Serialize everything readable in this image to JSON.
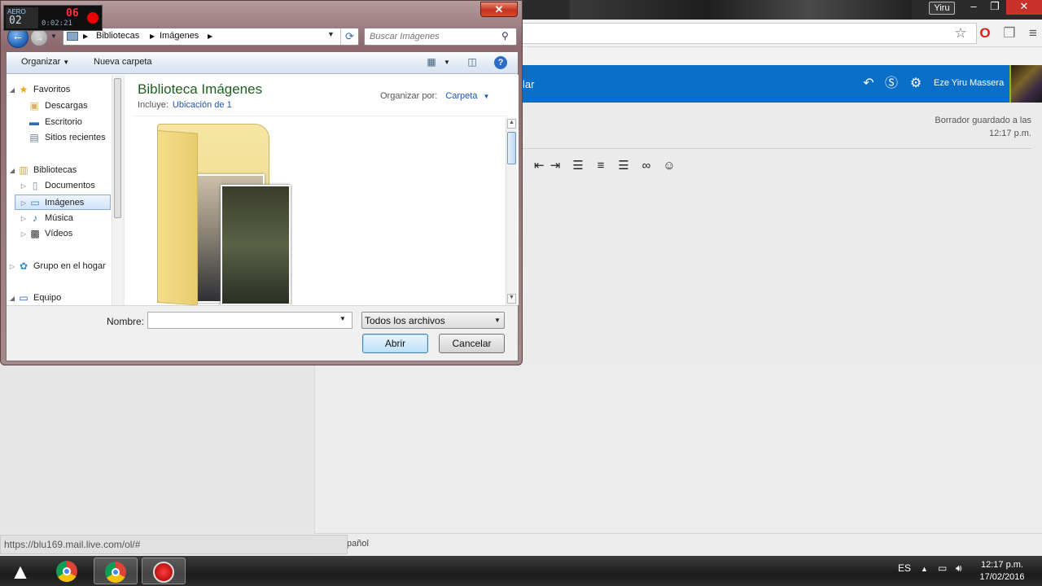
{
  "browser": {
    "user_chip": "Yiru",
    "window_buttons": [
      "–",
      "❐",
      "✕"
    ],
    "status_url": "https://blu169.mail.live.com/ol/#"
  },
  "outlook": {
    "partial_label": "lar",
    "user_name": "Eze Yiru Massera",
    "draft_line1": "Borrador guardado a las",
    "draft_line2": "12:17 p.m.",
    "footer_partial": "pañol",
    "accent_color": "#0a6fc9",
    "format_icons": [
      "decrease-indent-icon",
      "increase-indent-icon",
      "align-left-icon",
      "align-center-icon",
      "align-right-icon",
      "link-icon",
      "emoji-icon"
    ]
  },
  "recorder": {
    "label": "AERO",
    "count": "02",
    "counter_red": "06",
    "time": "0:02:21"
  },
  "dialog": {
    "close_label": "✕",
    "breadcrumb": [
      "Bibliotecas",
      "Imágenes"
    ],
    "search_placeholder": "Buscar Imágenes",
    "toolbar": {
      "organize": "Organizar",
      "new_folder": "Nueva carpeta"
    },
    "nav": {
      "favorites": "Favoritos",
      "downloads": "Descargas",
      "desktop": "Escritorio",
      "recent": "Sitios recientes",
      "libraries": "Bibliotecas",
      "documents": "Documentos",
      "images": "Imágenes",
      "music": "Música",
      "videos": "Vídeos",
      "homegroup": "Grupo en el hogar",
      "computer": "Equipo"
    },
    "library_title": "Biblioteca Imágenes",
    "includes_label": "Incluye:",
    "includes_link": "Ubicación de 1",
    "arrange_label": "Organizar por:",
    "arrange_value": "Carpeta",
    "name_label": "Nombre:",
    "name_value": "",
    "file_type": "Todos los archivos",
    "open_button": "Abrir",
    "cancel_button": "Cancelar"
  },
  "taskbar": {
    "lang": "ES",
    "time": "12:17 p.m.",
    "date": "17/02/2016"
  }
}
